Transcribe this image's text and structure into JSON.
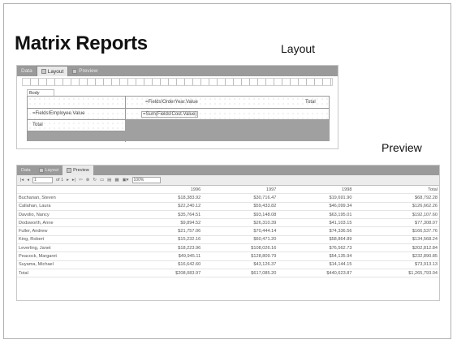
{
  "slide": {
    "title": "Matrix Reports",
    "layout_caption": "Layout",
    "preview_caption": "Preview"
  },
  "layout_view": {
    "tabs": [
      "Data",
      "Layout",
      "Preview"
    ],
    "body_tab": "Body",
    "column_group_expr": "=Fields!OrderYear.Value",
    "total_column": "Total",
    "row_group_expr": "=Fields!Employee.Value",
    "data_expr": "=Sum(Fields!Cost.Value)",
    "total_row": "Total"
  },
  "preview_view": {
    "tabs": [
      "Data",
      "Layout",
      "Preview"
    ],
    "page_field": "1",
    "page_of": "of 1",
    "zoom": "100%",
    "columns": [
      "",
      "1996",
      "1997",
      "1998",
      "Total"
    ],
    "rows": [
      [
        "Buchanan, Steven",
        "$18,383.92",
        "$30,716.47",
        "$19,691.90",
        "$68,792.28"
      ],
      [
        "Callahan, Laura",
        "$22,240.12",
        "$59,433.82",
        "$46,099.34",
        "$126,662.26"
      ],
      [
        "Davolio, Nancy",
        "$35,764.51",
        "$93,148.08",
        "$63,195.01",
        "$192,107.60"
      ],
      [
        "Dodsworth, Anne",
        "$9,894.52",
        "$26,310.39",
        "$41,103.15",
        "$77,308.07"
      ],
      [
        "Fuller, Andrew",
        "$21,757.06",
        "$70,444.14",
        "$74,336.56",
        "$166,537.76"
      ],
      [
        "King, Robert",
        "$15,232.16",
        "$60,471.20",
        "$58,864.89",
        "$134,568.24"
      ],
      [
        "Leverling, Janet",
        "$18,223.96",
        "$108,026.16",
        "$76,562.73",
        "$202,812.84"
      ],
      [
        "Peacock, Margaret",
        "$49,945.11",
        "$128,809.79",
        "$54,135.94",
        "$232,890.85"
      ],
      [
        "Suyama, Michael",
        "$16,642.60",
        "$43,126.37",
        "$14,144.15",
        "$73,913.13"
      ],
      [
        "Total",
        "$208,083.97",
        "$617,085.20",
        "$440,623.87",
        "$1,265,793.04"
      ]
    ]
  }
}
